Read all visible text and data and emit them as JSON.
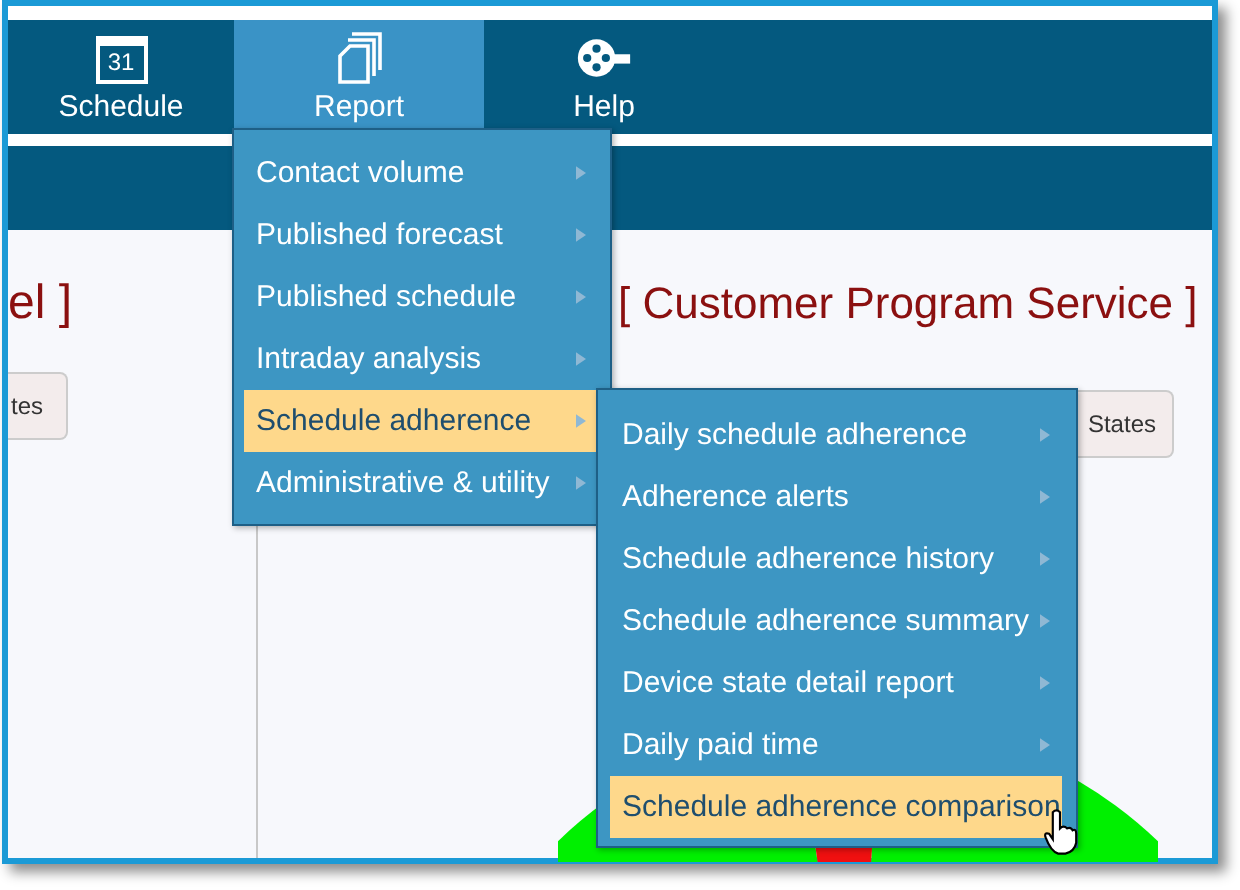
{
  "nav": [
    {
      "label": "Schedule",
      "icon_text": "31",
      "selected": false
    },
    {
      "label": "Report",
      "selected": true
    },
    {
      "label": "Help",
      "selected": false
    }
  ],
  "report_menu": [
    {
      "label": "Contact volume",
      "has_submenu": true,
      "selected": false
    },
    {
      "label": "Published forecast",
      "has_submenu": true,
      "selected": false
    },
    {
      "label": "Published schedule",
      "has_submenu": true,
      "selected": false
    },
    {
      "label": "Intraday analysis",
      "has_submenu": true,
      "selected": false
    },
    {
      "label": "Schedule adherence",
      "has_submenu": true,
      "selected": true
    },
    {
      "label": "Administrative & utility",
      "has_submenu": true,
      "selected": false
    }
  ],
  "submenu": [
    {
      "label": "Daily schedule adherence",
      "has_submenu": true,
      "selected": false
    },
    {
      "label": "Adherence alerts",
      "has_submenu": true,
      "selected": false
    },
    {
      "label": "Schedule adherence history",
      "has_submenu": true,
      "selected": false
    },
    {
      "label": "Schedule adherence summary",
      "has_submenu": true,
      "selected": false
    },
    {
      "label": "Device state detail report",
      "has_submenu": true,
      "selected": false
    },
    {
      "label": "Daily paid time",
      "has_submenu": true,
      "selected": false
    },
    {
      "label": "Schedule adherence comparison",
      "has_submenu": false,
      "selected": true
    }
  ],
  "left_panel": {
    "title": "el ]",
    "button": "tes"
  },
  "main_panel": {
    "title": "[ Customer Program Service ]",
    "button": "States"
  }
}
